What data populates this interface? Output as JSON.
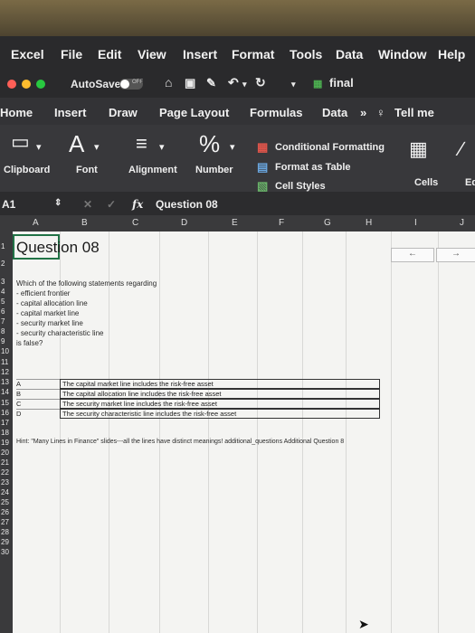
{
  "menu": {
    "app": "Excel",
    "items": [
      "File",
      "Edit",
      "View",
      "Insert",
      "Format",
      "Tools",
      "Data",
      "Window",
      "Help"
    ]
  },
  "toolbar": {
    "autosave_label": "AutoSave",
    "autosave_state": "OFF",
    "filename": "final"
  },
  "ribbon_tabs": [
    "Home",
    "Insert",
    "Draw",
    "Page Layout",
    "Formulas",
    "Data",
    "Tell me"
  ],
  "ribbon": {
    "groups": [
      "Clipboard",
      "Font",
      "Alignment",
      "Number",
      "Cells"
    ],
    "styles": [
      "Conditional Formatting",
      "Format as Table",
      "Cell Styles"
    ],
    "font_glyph": "A",
    "number_glyph": "%",
    "cut_label": "Ed"
  },
  "formula_bar": {
    "cell_ref": "A1",
    "fx": "fx",
    "content": "Question 08"
  },
  "columns": [
    "A",
    "B",
    "C",
    "D",
    "E",
    "F",
    "G",
    "H",
    "I",
    "J"
  ],
  "rows": [
    "1",
    "2",
    "3",
    "4",
    "5",
    "6",
    "7",
    "8",
    "9",
    "10",
    "11",
    "12",
    "13",
    "14",
    "15",
    "16",
    "17",
    "18",
    "19",
    "20",
    "21",
    "22",
    "23",
    "24",
    "25",
    "26",
    "27",
    "28",
    "29",
    "30"
  ],
  "sheet": {
    "title": "Question 08",
    "question": [
      "Which of the following statements regarding",
      "- efficient frontier",
      "- capital allocation line",
      "- capital market line",
      "- security market line",
      "- security characteristic line",
      "is false?"
    ],
    "options": [
      {
        "letter": "A",
        "text": "The capital market line includes the risk-free asset"
      },
      {
        "letter": "B",
        "text": "The capital allocation line includes the risk-free asset"
      },
      {
        "letter": "C",
        "text": "The security market line includes the risk-free asset"
      },
      {
        "letter": "D",
        "text": "The security characteristic line includes the risk-free asset"
      }
    ],
    "hint": "Hint: \"Many Lines in Finance\" slides---all the lines have distinct meanings! additional_questions Additional Question 8",
    "nav_prev": "←",
    "nav_next": "→"
  }
}
